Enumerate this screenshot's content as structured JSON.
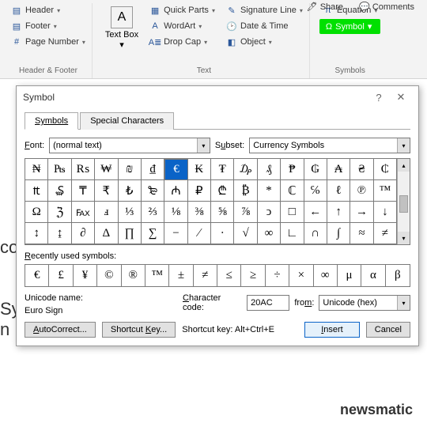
{
  "top_actions": {
    "share": "Share",
    "comments": "Comments"
  },
  "ribbon": {
    "header_footer": {
      "label": "Header & Footer",
      "header": "Header",
      "footer": "Footer",
      "page_number": "Page Number"
    },
    "text_group": {
      "label": "Text",
      "text_box": "Text\nBox",
      "quick_parts": "Quick Parts",
      "wordart": "WordArt",
      "drop_cap": "Drop Cap",
      "sig_line": "Signature Line",
      "date_time": "Date & Time",
      "object": "Object"
    },
    "symbols": {
      "label": "Symbols",
      "equation": "Equation",
      "symbol": "Symbol"
    }
  },
  "dialog": {
    "title": "Symbol",
    "tabs": {
      "symbols": "Symbols",
      "special": "Special Characters"
    },
    "font_label": "Font:",
    "font_value": "(normal text)",
    "subset_label": "Subset:",
    "subset_value": "Currency Symbols",
    "grid": [
      "₦",
      "₧",
      "₨",
      "₩",
      "₪",
      "₫",
      "€",
      "₭",
      "₮",
      "₯",
      "₰",
      "₱",
      "₲",
      "₳",
      "₴",
      "₵",
      "₶",
      "₷",
      "₸",
      "₹",
      "₺",
      "₻",
      "₼",
      "₽",
      "₾",
      "₿",
      "*",
      "ℂ",
      "℅",
      "ℓ",
      "℗",
      "™",
      "Ω",
      "ℨ",
      "℻",
      "ⅎ",
      "⅓",
      "⅔",
      "⅛",
      "⅜",
      "⅝",
      "⅞",
      "ↄ",
      "□",
      "←",
      "↑",
      "→",
      "↓",
      "↕",
      "↨",
      "∂",
      "Δ",
      "∏",
      "∑",
      "−",
      "∕",
      "∙",
      "√",
      "∞",
      "∟",
      "∩",
      "∫",
      "≈",
      "≠"
    ],
    "recent_label": "Recently used symbols:",
    "recent": [
      "€",
      "£",
      "¥",
      "©",
      "®",
      "™",
      "±",
      "≠",
      "≤",
      "≥",
      "÷",
      "×",
      "∞",
      "μ",
      "α",
      "β"
    ],
    "unicode_name_label": "Unicode name:",
    "unicode_name": "Euro Sign",
    "char_code_label": "Character code:",
    "char_code": "20AC",
    "from_label": "from:",
    "from_value": "Unicode (hex)",
    "autocorrect": "AutoCorrect...",
    "shortcut_btn": "Shortcut Key...",
    "shortcut_text": "Shortcut key: Alt+Ctrl+E",
    "insert": "Insert",
    "cancel": "Cancel"
  },
  "watermark": "newsmatic",
  "selected_glyph": "€"
}
